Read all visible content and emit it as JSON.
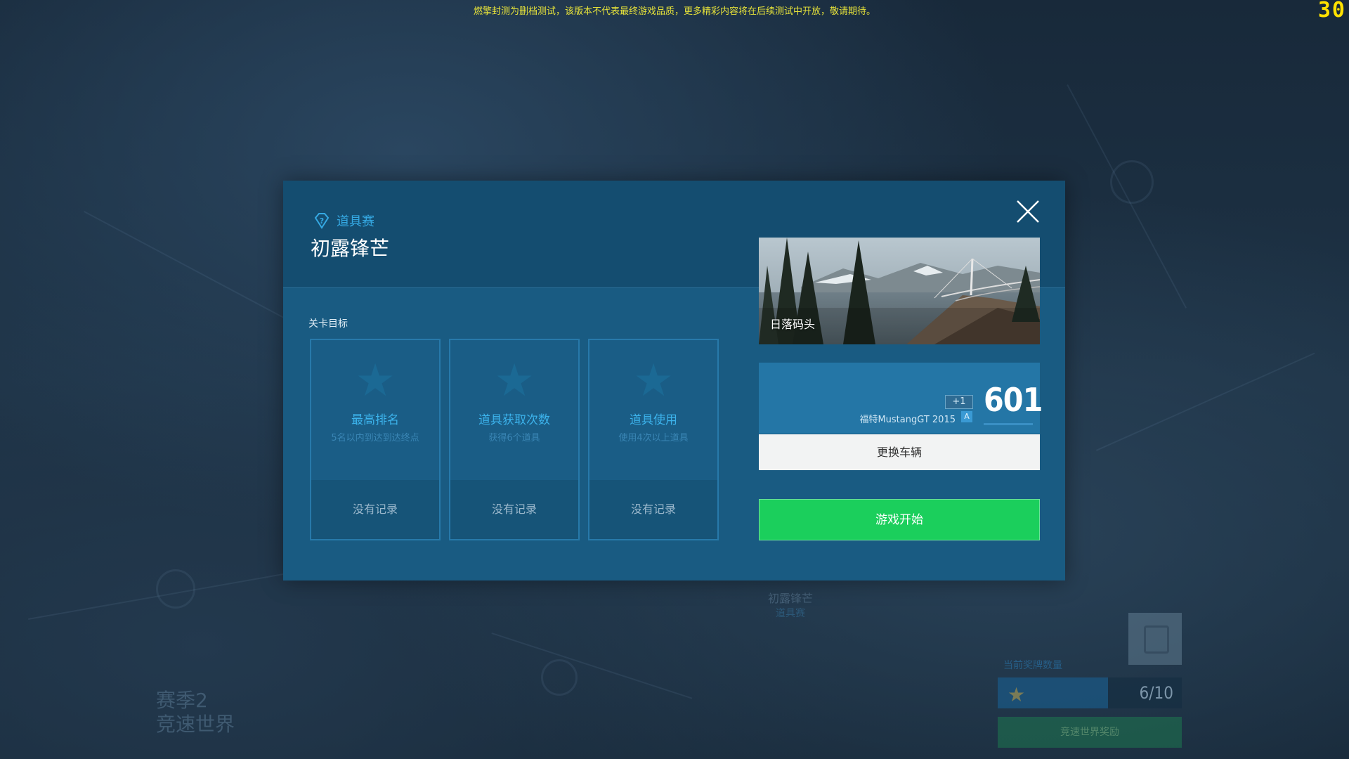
{
  "notice": "燃擎封测为删档测试，该版本不代表最终游戏品质，更多精彩内容将在后续测试中开放，敬请期待。",
  "fps": "30",
  "background": {
    "season_line1": "赛季2",
    "season_line2": "竞速世界",
    "map_node_title": "初露锋芒",
    "map_node_mode": "道具赛",
    "reward_label": "当前奖牌数量",
    "reward_progress": 0.6,
    "reward_count": "6/10",
    "reward_button": "竞速世界奖励"
  },
  "modal": {
    "mode_label": "道具赛",
    "mode_icon": "item-race-icon",
    "stage_title": "初露锋芒",
    "section_label": "关卡目标",
    "goals": [
      {
        "title": "最高排名",
        "desc": "5名以内到达到达终点",
        "record": "没有记录",
        "icon": "star-icon"
      },
      {
        "title": "道具获取次数",
        "desc": "获得6个道具",
        "record": "没有记录",
        "icon": "star-icon"
      },
      {
        "title": "道具使用",
        "desc": "使用4次以上道具",
        "record": "没有记录",
        "icon": "star-icon"
      }
    ],
    "track_name": "日落码头",
    "car": {
      "name": "福特MustangGT 2015",
      "plus": "+1",
      "rank": "A",
      "score": "601"
    },
    "change_car_label": "更换车辆",
    "start_label": "游戏开始"
  },
  "colors": {
    "accent": "#35a9e3",
    "start_green": "#1bcf5c",
    "modal_bg": "#195b82",
    "notice_yellow": "#e6e23a"
  }
}
